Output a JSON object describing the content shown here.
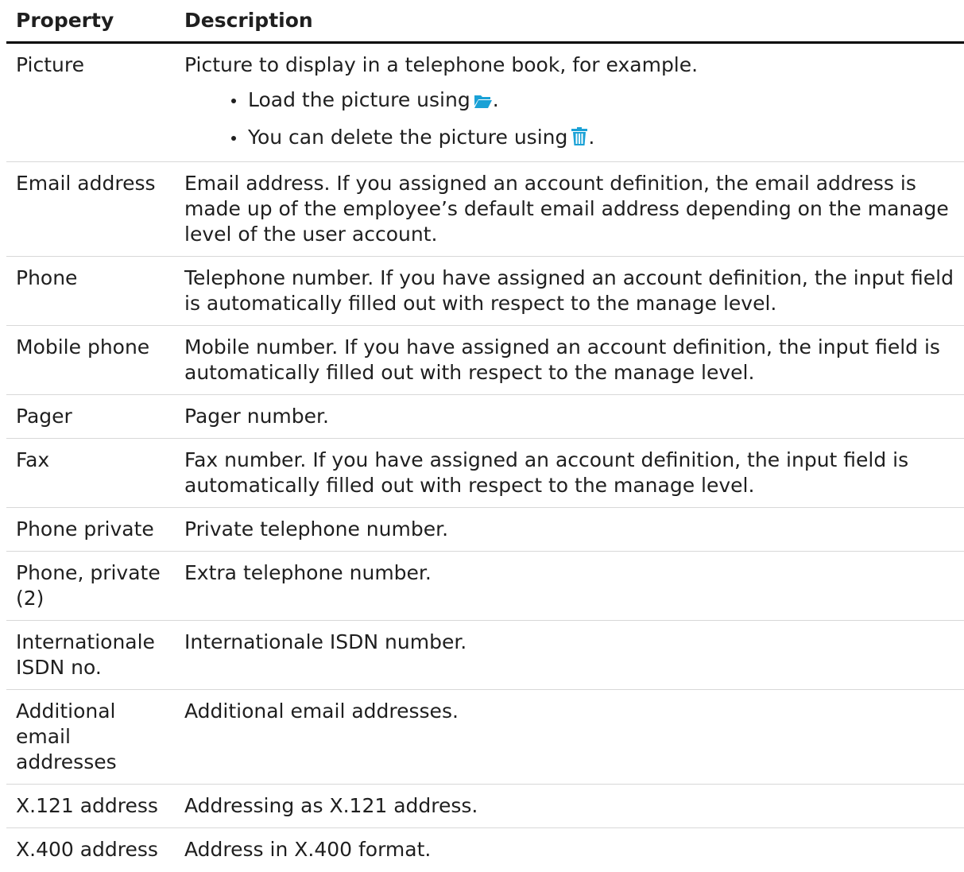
{
  "header": {
    "property": "Property",
    "description": "Description"
  },
  "rows": [
    {
      "property": "Picture",
      "description": "Picture to display in a telephone book, for example.",
      "bullets": [
        {
          "text": "Load the picture using",
          "icon": "folder-open-icon",
          "suffix": "."
        },
        {
          "text": "You can delete the picture using",
          "icon": "trash-icon",
          "suffix": "."
        }
      ]
    },
    {
      "property": "Email address",
      "description": "Email address. If you assigned an account definition, the email address is made up of the employee’s default email address depending on the manage level of the user account."
    },
    {
      "property": "Phone",
      "description": "Telephone number. If you have assigned an account definition, the input field is automatically filled out with respect to the manage level."
    },
    {
      "property": "Mobile phone",
      "description": "Mobile number. If you have assigned an account definition, the input field is automatically filled out with respect to the manage level."
    },
    {
      "property": "Pager",
      "description": "Pager number."
    },
    {
      "property": "Fax",
      "description": "Fax number. If you have assigned an account definition, the input field is automatically filled out with respect to the manage level."
    },
    {
      "property": "Phone private",
      "description": "Private telephone number."
    },
    {
      "property": "Phone, private (2)",
      "description": "Extra telephone number."
    },
    {
      "property": "Internationale ISDN no.",
      "description": "Internationale ISDN number."
    },
    {
      "property": "Additional email addresses",
      "description": "Additional email addresses."
    },
    {
      "property": "X.121 address",
      "description": "Addressing as X.121 address."
    },
    {
      "property": "X.400 address",
      "description": "Address in X.400 format."
    }
  ],
  "colors": {
    "icon_accent": "#1aa1d6"
  }
}
